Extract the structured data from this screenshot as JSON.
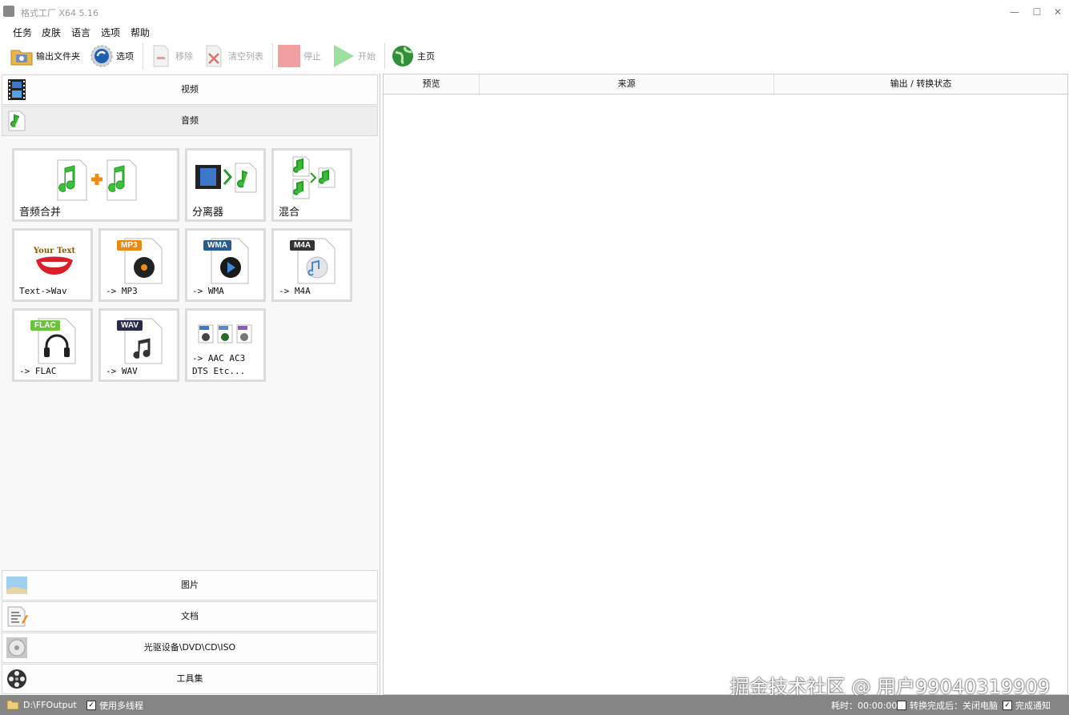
{
  "window": {
    "title": "格式工厂 X64 5.16",
    "minimize": "—",
    "maximize": "☐",
    "close": "✕"
  },
  "menu": [
    "任务",
    "皮肤",
    "语言",
    "选项",
    "帮助"
  ],
  "toolbar": {
    "output_folder": "输出文件夹",
    "options": "选项",
    "remove": "移除",
    "clear_list": "清空列表",
    "stop": "停止",
    "start": "开始",
    "home": "主页"
  },
  "categories": {
    "video": "视频",
    "audio": "音频",
    "picture": "图片",
    "document": "文档",
    "optical": "光驱设备\\DVD\\CD\\ISO",
    "tools": "工具集"
  },
  "tiles": {
    "audio_merge": "音频合并",
    "splitter": "分离器",
    "mix": "混合",
    "text_wav": "Text->Wav",
    "text_art": "Your Text",
    "mp3": "-> MP3",
    "mp3_badge": "MP3",
    "wma": "-> WMA",
    "wma_badge": "WMA",
    "m4a": "-> M4A",
    "m4a_badge": "M4A",
    "flac": "-> FLAC",
    "flac_badge": "FLAC",
    "wav": "-> WAV",
    "wav_badge": "WAV",
    "aac_line1": "-> AAC AC3",
    "aac_line2": "DTS Etc..."
  },
  "list_headers": {
    "preview": "预览",
    "source": "来源",
    "output_status": "输出 / 转换状态"
  },
  "status": {
    "output_path": "D:\\FFOutput",
    "multithread": "使用多线程",
    "elapsed": "耗时：00:00:00",
    "after_done": "转换完成后：关闭电脑",
    "notify": "完成通知"
  },
  "watermark": "掘金技术社区 @ 用户99040319909"
}
